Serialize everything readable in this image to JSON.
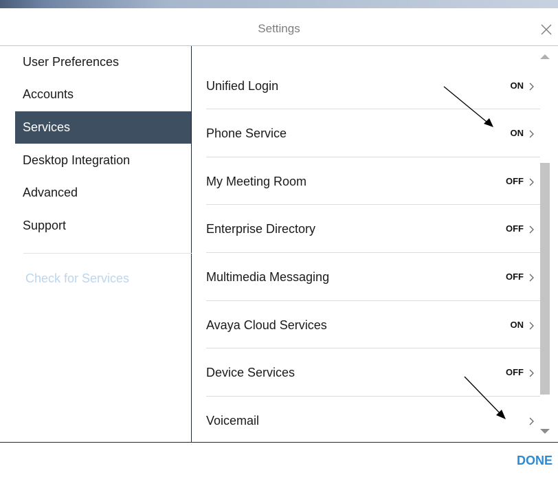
{
  "dialog": {
    "title": "Settings",
    "done_label": "DONE"
  },
  "sidebar": {
    "items": [
      {
        "label": "User Preferences",
        "active": false
      },
      {
        "label": "Accounts",
        "active": false
      },
      {
        "label": "Services",
        "active": true
      },
      {
        "label": "Desktop Integration",
        "active": false
      },
      {
        "label": "Advanced",
        "active": false
      },
      {
        "label": "Support",
        "active": false
      }
    ],
    "check_services_label": "Check for Services"
  },
  "services": [
    {
      "label": "Unified Login",
      "state": "ON"
    },
    {
      "label": "Phone Service",
      "state": "ON"
    },
    {
      "label": "My Meeting Room",
      "state": "OFF"
    },
    {
      "label": "Enterprise Directory",
      "state": "OFF"
    },
    {
      "label": "Multimedia Messaging",
      "state": "OFF"
    },
    {
      "label": "Avaya Cloud Services",
      "state": "ON"
    },
    {
      "label": "Device Services",
      "state": "OFF"
    },
    {
      "label": "Voicemail",
      "state": ""
    }
  ],
  "colors": {
    "active_bg": "#3d4f60",
    "accent": "#2a8ad4",
    "disabled_link": "#bcd6ee"
  },
  "icons": {
    "close": "close-icon",
    "chevron": "chevron-right-icon",
    "scroll_up": "scroll-up-arrow-icon",
    "scroll_down": "scroll-down-arrow-icon"
  }
}
